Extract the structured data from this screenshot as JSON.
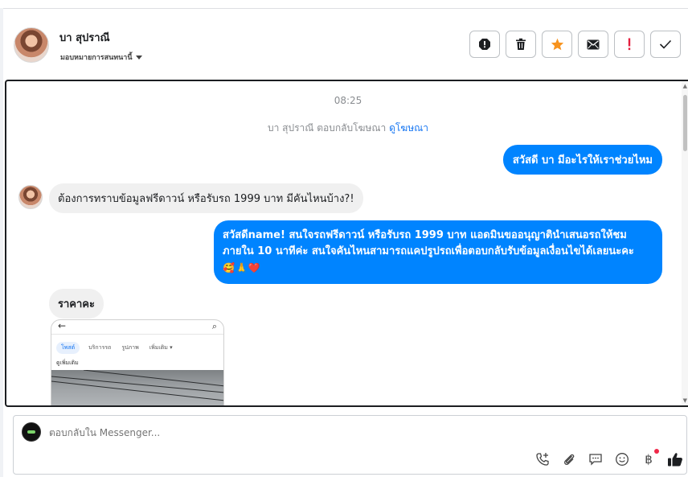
{
  "header": {
    "contact_name": "บา สุปราณี",
    "assign_label": "มอบหมายการสนทนานี้",
    "actions": [
      {
        "name": "spam-icon"
      },
      {
        "name": "trash-icon"
      },
      {
        "name": "star-icon"
      },
      {
        "name": "mail-icon"
      },
      {
        "name": "important-icon"
      },
      {
        "name": "check-icon"
      }
    ],
    "colors": {
      "star": "#f7931e",
      "important": "#e41e3f"
    }
  },
  "chat": {
    "timestamp": "08:25",
    "replied_text": "บา สุปราณี ตอบกลับโฆษณา",
    "view_ad_link": "ดูโฆษณา",
    "messages": [
      {
        "direction": "out",
        "text": "สวัสดี บา มีอะไรให้เราช่วยไหม"
      },
      {
        "direction": "in",
        "text": "ต้องการทราบข้อมูลฟรีดาวน์ หรือรับรถ 1999 บาท มีคันไหนบ้าง?!"
      },
      {
        "direction": "out",
        "text": "สวัสดีname! สนใจรถฟรีดาวน์ หรือรับรถ 1999 บาท แอดมินขออนุญาตินำเสนอรถให้ชมภายใน 10 นาทีค่ะ สนใจคันไหนสามารถแคปรูปรถเพื่อตอบกลับรับข้อมูลเงื่อนไขได้เลยนะคะ",
        "emoji": "🥰🙏❤️"
      },
      {
        "direction": "in",
        "text": "ราคาคะ"
      }
    ],
    "attachment": {
      "tabs": [
        "โพสต์",
        "บริการรถ",
        "รูปภาพ",
        "เพิ่มเติม ▾"
      ],
      "active_tab": 0,
      "caption": "ดูเพิ่มเติม"
    },
    "bubble_out_color": "#0084ff",
    "bubble_in_color": "#f0f0f0"
  },
  "composer": {
    "placeholder": "ตอบกลับใน Messenger...",
    "tools": [
      {
        "name": "call-icon"
      },
      {
        "name": "attachment-icon"
      },
      {
        "name": "saved-replies-icon"
      },
      {
        "name": "emoji-icon"
      },
      {
        "name": "payment-icon",
        "glyph": "฿"
      },
      {
        "name": "like-icon"
      }
    ]
  }
}
